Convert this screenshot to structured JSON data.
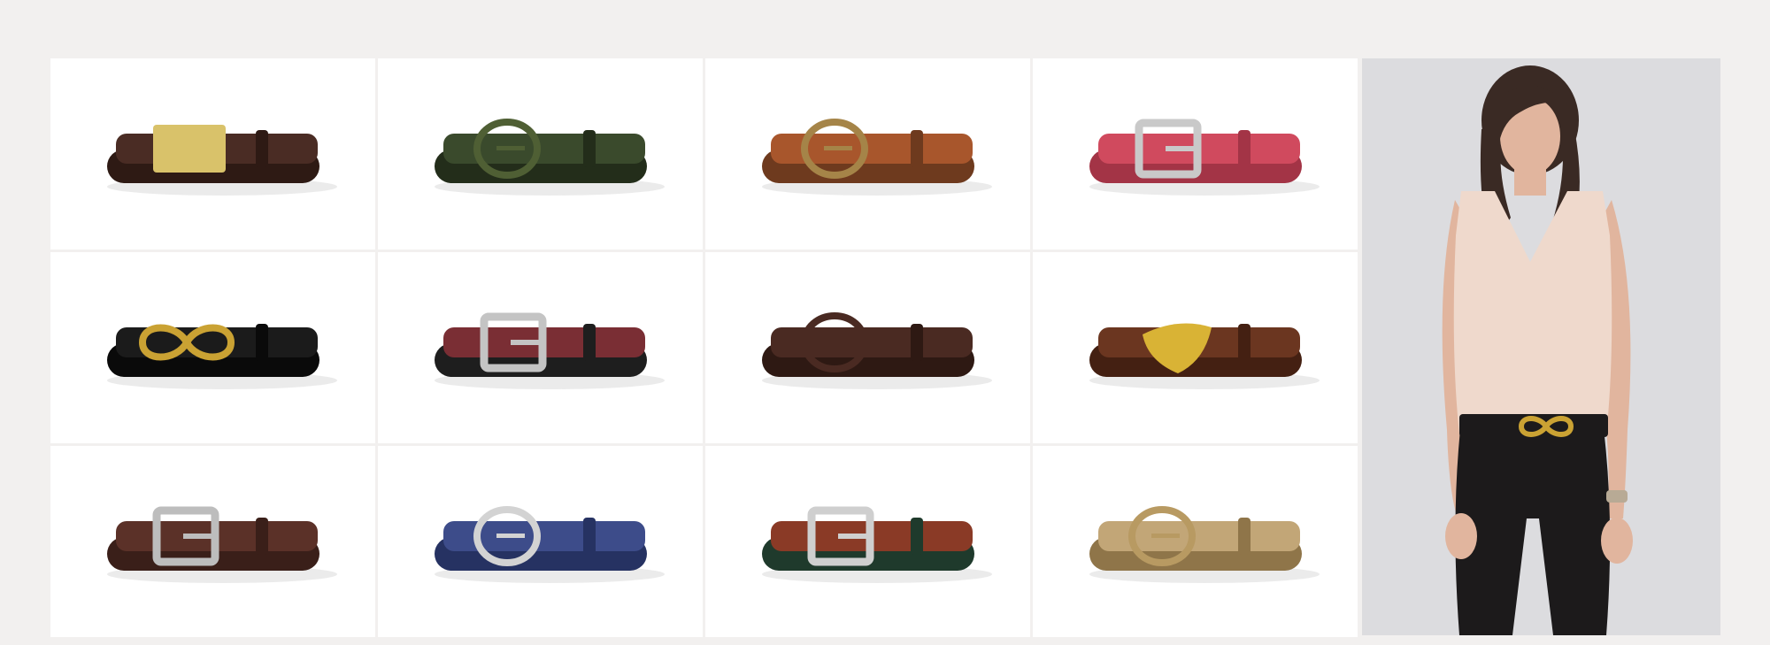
{
  "gallery": {
    "products": [
      {
        "name": "brown-croc-gold-plaque-belt",
        "strap": "#4a2c24",
        "dark": "#2e1a14",
        "buckle": "#d9c26a",
        "style": "plaque"
      },
      {
        "name": "olive-croc-belt",
        "strap": "#3a4a2c",
        "dark": "#232d1a",
        "buckle": "#4f5f34",
        "style": "ring"
      },
      {
        "name": "braided-tan-rust-belt",
        "strap": "#a8562c",
        "dark": "#6e3a1e",
        "buckle": "#a58448",
        "style": "ring"
      },
      {
        "name": "pink-lizard-silver-buckle-belt",
        "strap": "#d04a5e",
        "dark": "#a33446",
        "buckle": "#c9c9c9",
        "style": "square"
      },
      {
        "name": "black-gold-infinity-belt",
        "strap": "#1b1b1b",
        "dark": "#0a0a0a",
        "buckle": "#caa233",
        "style": "infinity"
      },
      {
        "name": "black-burgundy-stripe-belt",
        "strap": "#7a2e34",
        "dark": "#1e1e1e",
        "buckle": "#c4c4c4",
        "style": "square"
      },
      {
        "name": "dark-brown-lizard-belt",
        "strap": "#4a2a22",
        "dark": "#2e1913",
        "buckle": "#4a2a22",
        "style": "ring"
      },
      {
        "name": "brown-croc-gold-shield-belt",
        "strap": "#6b3620",
        "dark": "#442012",
        "buckle": "#d9b335",
        "style": "shield"
      },
      {
        "name": "brown-leather-silver-buckle-belt",
        "strap": "#5b3128",
        "dark": "#3a1f19",
        "buckle": "#bdbdbd",
        "style": "square"
      },
      {
        "name": "navy-lizard-silver-buckle-belt",
        "strap": "#3d4c8a",
        "dark": "#263262",
        "buckle": "#d3d3d3",
        "style": "ring"
      },
      {
        "name": "croc-woven-green-belt",
        "strap": "#8a3a26",
        "dark": "#1f3a2c",
        "buckle": "#cfcfcf",
        "style": "square"
      },
      {
        "name": "tan-croc-belt",
        "strap": "#c2a677",
        "dark": "#8f7549",
        "buckle": "#b89a62",
        "style": "ring"
      }
    ]
  },
  "model": {
    "backdrop": "#dcdcdf",
    "top_color": "#efd9cc",
    "pants_color": "#1c1a1b",
    "hair_color": "#3a2a24",
    "skin_color": "#e1b59e",
    "buckle_color": "#caa233"
  }
}
